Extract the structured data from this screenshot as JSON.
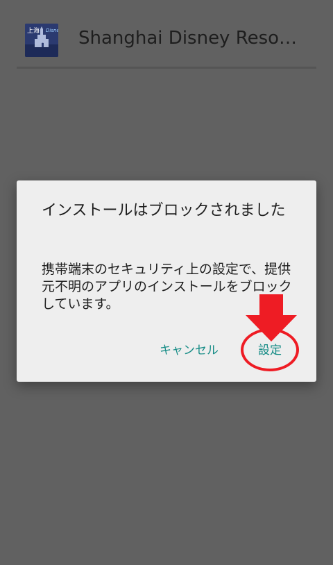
{
  "header": {
    "app_name": "Shanghai Disney Reso…",
    "icon_name": "shanghai-disney-app-icon"
  },
  "dialog": {
    "title": "インストールはブロックされました",
    "message": "携帯端末のセキュリティ上の設定で、提供元不明のアプリのインストールをブロックしています。",
    "cancel_label": "キャンセル",
    "settings_label": "設定"
  },
  "annotation": {
    "arrow_icon": "red-down-arrow-icon",
    "highlight": "red-circle-highlight",
    "color": "#ee1c24"
  },
  "colors": {
    "background_dim": "#616161",
    "dialog_bg": "#eeeeee",
    "accent": "#168c86"
  }
}
